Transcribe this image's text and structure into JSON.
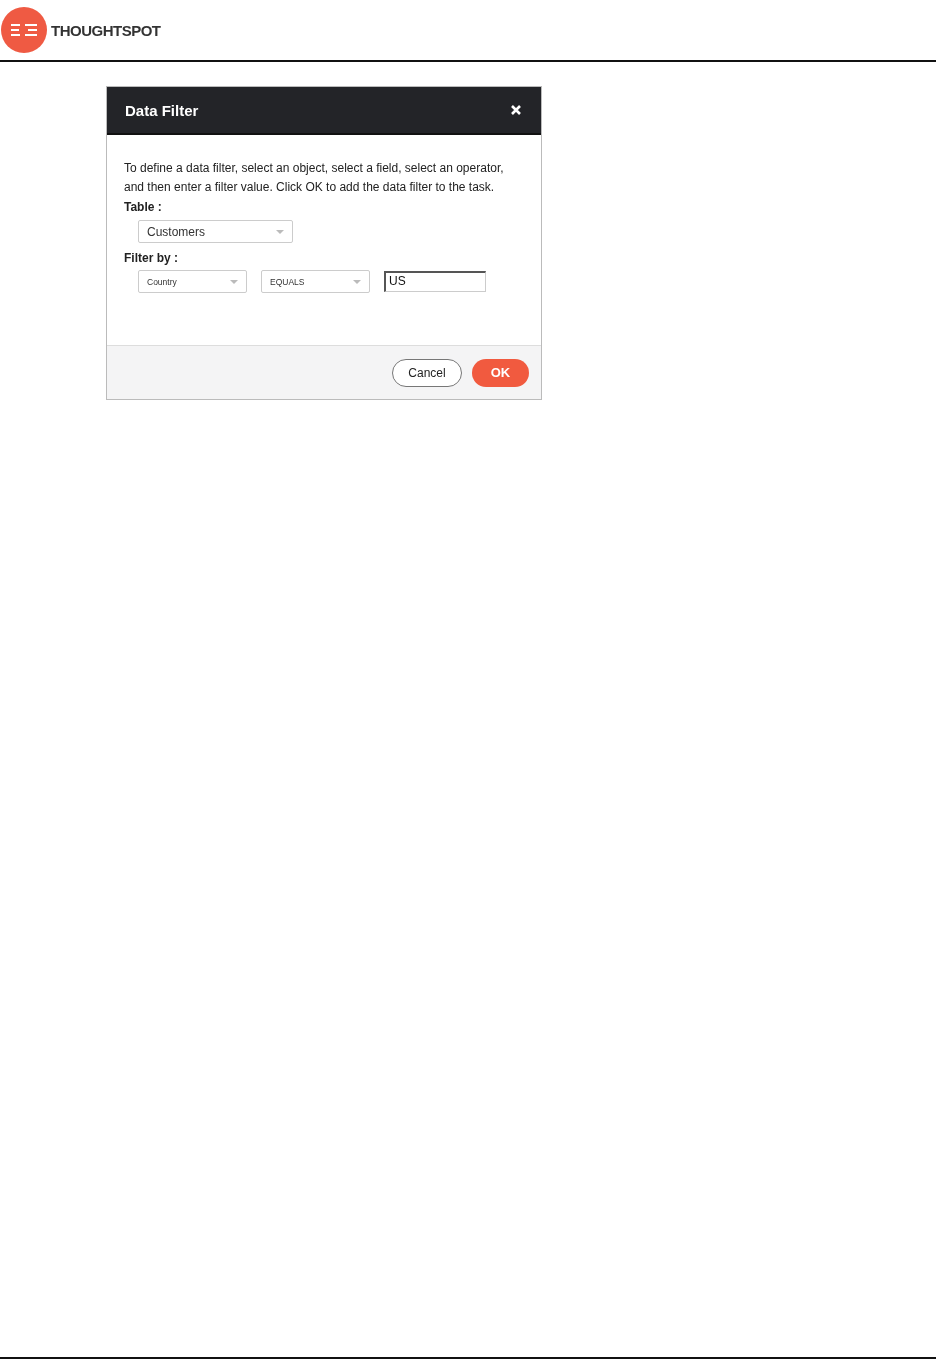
{
  "header": {
    "brand": "THOUGHTSPOT"
  },
  "dialog": {
    "title": "Data Filter",
    "description": "To define a data filter, select an object, select a field, select an operator, and then enter a filter value. Click OK to add the data filter to the task.",
    "table_label": "Table :",
    "table_select": "Customers",
    "filter_label": "Filter by :",
    "field_select": "Country",
    "operator_select": "EQUALS",
    "value_input": "US",
    "buttons": [
      {
        "label": "Cancel",
        "kind": "secondary"
      },
      {
        "label": "OK",
        "kind": "primary"
      }
    ]
  }
}
